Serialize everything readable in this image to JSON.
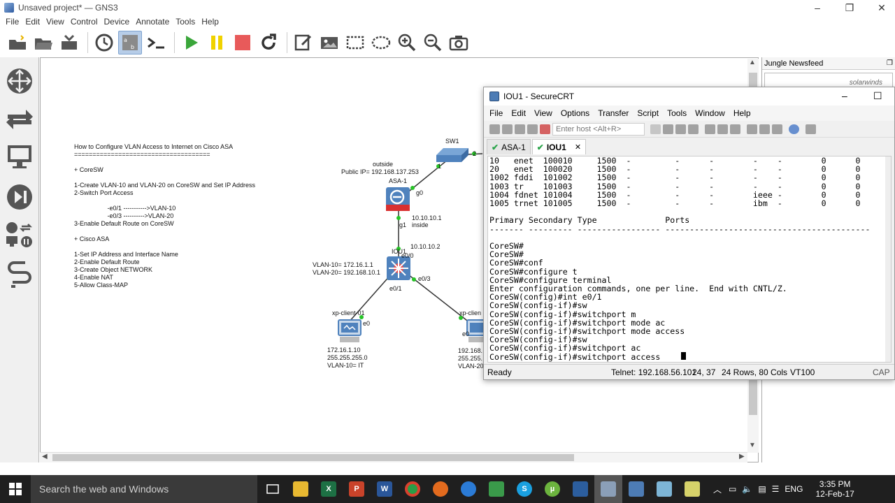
{
  "window": {
    "title": "Unsaved project* — GNS3",
    "minimize": "–",
    "maximize": "❐",
    "close": "✕"
  },
  "menu": [
    "File",
    "Edit",
    "View",
    "Control",
    "Device",
    "Annotate",
    "Tools",
    "Help"
  ],
  "toolbar": [
    "new-project-icon",
    "open-icon",
    "save-icon",
    "snapshot-clock-icon",
    "show-interface-labels-icon",
    "console-all-icon",
    "start-icon",
    "pause-icon",
    "stop-icon",
    "reload-icon",
    "note-icon",
    "insert-picture-icon",
    "rectangle-icon",
    "ellipse-icon",
    "zoom-in-icon",
    "zoom-out-icon",
    "screenshot-icon"
  ],
  "sidebar": [
    "routers-icon",
    "switches-icon",
    "end-devices-icon",
    "security-devices-icon",
    "all-devices-icon",
    "add-link-icon"
  ],
  "canvas": {
    "note": "How to Configure VLAN Access to Internet on Cisco ASA\n=====================================\n\n+ CoreSW\n\n1-Create VLAN-10 and VLAN-20 on CoreSW and Set IP Address\n2-Switch Port Access\n\n                   -e0/1 ----------->VLAN-10\n                   -e0/3 ---------->VLAN-20\n3-Enable Default Route on CoreSW\n\n+ Cisco ASA\n\n1-Set IP Address and Interface Name\n2-Enable Default Route\n3-Create Object NETWORK\n4-Enable NAT\n5-Allow Class-MAP",
    "nodes": {
      "sw1": "SW1",
      "asa": "ASA-1",
      "iou": "IOU1",
      "xp1": "xp-client-01",
      "xp2": "xp-clien"
    },
    "labels": {
      "outside": "outside",
      "public_ip": "Public IP= 192.168.137.253",
      "g0": "g0",
      "g1": "g1",
      "ip1": "10.10.10.1",
      "inside": "inside",
      "ip2": "10.10.10.2",
      "e00": "e0/0",
      "vlan10": "VLAN-10= 172.16.1.1",
      "vlan20": "VLAN-20= 192.168.10.1",
      "e01": "e0/1",
      "e03": "e0/3",
      "sw_port": "1",
      "sw_port2": "2",
      "xp1_e0": "e0",
      "xp2_e0": "e0",
      "xp1_ip": "172.16.1.10",
      "xp1_mask": "255.255.255.0",
      "xp1_vlan": "VLAN-10= IT",
      "xp2_ip": "192.168.",
      "xp2_mask": "255.255.",
      "xp2_vlan": "VLAN-20"
    }
  },
  "newsfeed": {
    "title": "Jungle Newsfeed",
    "brand": "solarwinds"
  },
  "securecrt": {
    "title": "IOU1 - SecureCRT",
    "menu": [
      "File",
      "Edit",
      "View",
      "Options",
      "Transfer",
      "Script",
      "Tools",
      "Window",
      "Help"
    ],
    "host_placeholder": "Enter host <Alt+R>",
    "tabs": [
      {
        "label": "ASA-1",
        "active": false
      },
      {
        "label": "IOU1",
        "active": true
      }
    ],
    "tab_close": "✕",
    "terminal": "10   enet  100010     1500  -         -      -        -    -        0      0\n20   enet  100020     1500  -         -      -        -    -        0      0\n1002 fddi  101002     1500  -         -      -        -    -        0      0\n1003 tr    101003     1500  -         -      -        -    -        0      0\n1004 fdnet 101004     1500  -         -      -        ieee -        0      0\n1005 trnet 101005     1500  -         -      -        ibm  -        0      0\n\nPrimary Secondary Type              Ports\n------- --------- ----------------- ------------------------------------------\n\nCoreSW#\nCoreSW#\nCoreSW#conf\nCoreSW#configure t\nCoreSW#configure terminal\nEnter configuration commands, one per line.  End with CNTL/Z.\nCoreSW(config)#int e0/1\nCoreSW(config-if)#sw\nCoreSW(config-if)#switchport m\nCoreSW(config-if)#switchport mode ac\nCoreSW(config-if)#switchport mode access\nCoreSW(config-if)#sw\nCoreSW(config-if)#switchport ac\nCoreSW(config-if)#switchport access ",
    "status": {
      "left": "Ready",
      "telnet": "Telnet: 192.168.56.101",
      "pos": "24,  37",
      "size": "24 Rows, 80 Cols",
      "term": "VT100",
      "caps": "CAP"
    }
  },
  "taskbar": {
    "search": "Search the web and Windows",
    "apps": [
      "task-view-icon",
      "file-explorer-icon",
      "excel-icon",
      "powerpoint-icon",
      "word-icon",
      "chrome-icon",
      "firefox-icon",
      "globe-icon",
      "photos-icon",
      "skype-icon",
      "utorrent-icon",
      "virtualbox-icon",
      "gns3-icon",
      "securecrt-icon",
      "notepad-icon",
      "sticky-notes-icon"
    ],
    "lang": "ENG",
    "time": "3:35 PM",
    "date": "12-Feb-17"
  }
}
